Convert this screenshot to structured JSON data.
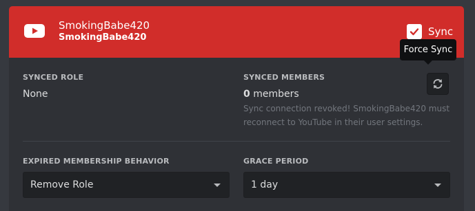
{
  "header": {
    "platform_icon": "youtube-icon",
    "channel_name": "SmokingBabe420",
    "channel_handle": "SmokingBabe420",
    "sync_checked": true,
    "sync_label": "Sync",
    "accent_color": "#d12d2a"
  },
  "tooltip": {
    "text": "Force Sync"
  },
  "synced_role": {
    "label": "SYNCED ROLE",
    "value": "None"
  },
  "synced_members": {
    "label": "SYNCED MEMBERS",
    "count": "0",
    "unit": "members",
    "note": "Sync connection revoked! SmokingBabe420 must reconnect to YouTube in their user settings.",
    "refresh_icon": "refresh-icon"
  },
  "expired_behavior": {
    "label": "EXPIRED MEMBERSHIP BEHAVIOR",
    "selected": "Remove Role"
  },
  "grace_period": {
    "label": "GRACE PERIOD",
    "selected": "1 day"
  }
}
